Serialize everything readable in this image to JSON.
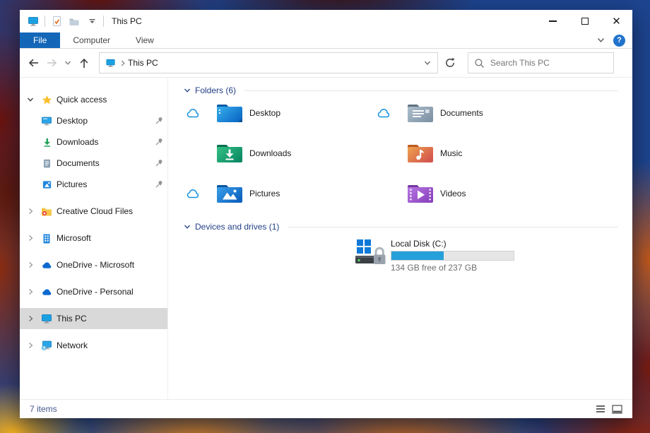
{
  "titlebar": {
    "title": "This PC",
    "quick_access_icons": [
      "this-pc",
      "properties-check",
      "new-folder",
      "customize-dropdown"
    ],
    "controls": [
      "minimize",
      "maximize",
      "close"
    ]
  },
  "ribbon": {
    "tabs": [
      {
        "label": "File",
        "active": true
      },
      {
        "label": "Computer",
        "active": false
      },
      {
        "label": "View",
        "active": false
      }
    ],
    "help_label": "?",
    "collapse_icon": "chevron-down"
  },
  "toolbar": {
    "nav_icons": [
      "back",
      "forward",
      "recent-locations",
      "up"
    ],
    "address": {
      "icon": "this-pc",
      "location": "This PC"
    },
    "refresh_icon": "refresh",
    "search": {
      "placeholder": "Search This PC"
    }
  },
  "sidebar": {
    "items": [
      {
        "label": "Quick access",
        "icon": "star",
        "expanded": true
      },
      {
        "label": "Desktop",
        "icon": "desktop",
        "pinned": true
      },
      {
        "label": "Downloads",
        "icon": "downloads",
        "pinned": true
      },
      {
        "label": "Documents",
        "icon": "documents",
        "pinned": true
      },
      {
        "label": "Pictures",
        "icon": "pictures",
        "pinned": true
      },
      {
        "label": "Creative Cloud Files",
        "icon": "creative-cloud-folder"
      },
      {
        "label": "Microsoft",
        "icon": "building"
      },
      {
        "label": "OneDrive - Microsoft",
        "icon": "onedrive-cloud"
      },
      {
        "label": "OneDrive - Personal",
        "icon": "onedrive-cloud"
      },
      {
        "label": "This PC",
        "icon": "this-pc",
        "selected": true
      },
      {
        "label": "Network",
        "icon": "network"
      }
    ]
  },
  "content": {
    "folders_header": "Folders (6)",
    "folders": [
      {
        "name": "Desktop",
        "icon": "folder-desktop",
        "cloud_status": true
      },
      {
        "name": "Documents",
        "icon": "folder-documents",
        "cloud_status": true
      },
      {
        "name": "Downloads",
        "icon": "folder-downloads",
        "cloud_status": false
      },
      {
        "name": "Music",
        "icon": "folder-music",
        "cloud_status": false
      },
      {
        "name": "Pictures",
        "icon": "folder-pictures",
        "cloud_status": true
      },
      {
        "name": "Videos",
        "icon": "folder-videos",
        "cloud_status": false
      }
    ],
    "devices_header": "Devices and drives (1)",
    "drive": {
      "name": "Local Disk (C:)",
      "capacity_text": "134 GB free of 237 GB",
      "used_percent": 43,
      "bar_color": "#26a0da",
      "icon": "local-disk-bitlocker"
    }
  },
  "statusbar": {
    "items_count": "7 items",
    "view_icons": [
      "details-view",
      "thumbnail-view"
    ]
  },
  "colors": {
    "accent_blue": "#1467b8",
    "group_header_blue": "#233f87",
    "selection_gray": "#d9d9d9"
  }
}
